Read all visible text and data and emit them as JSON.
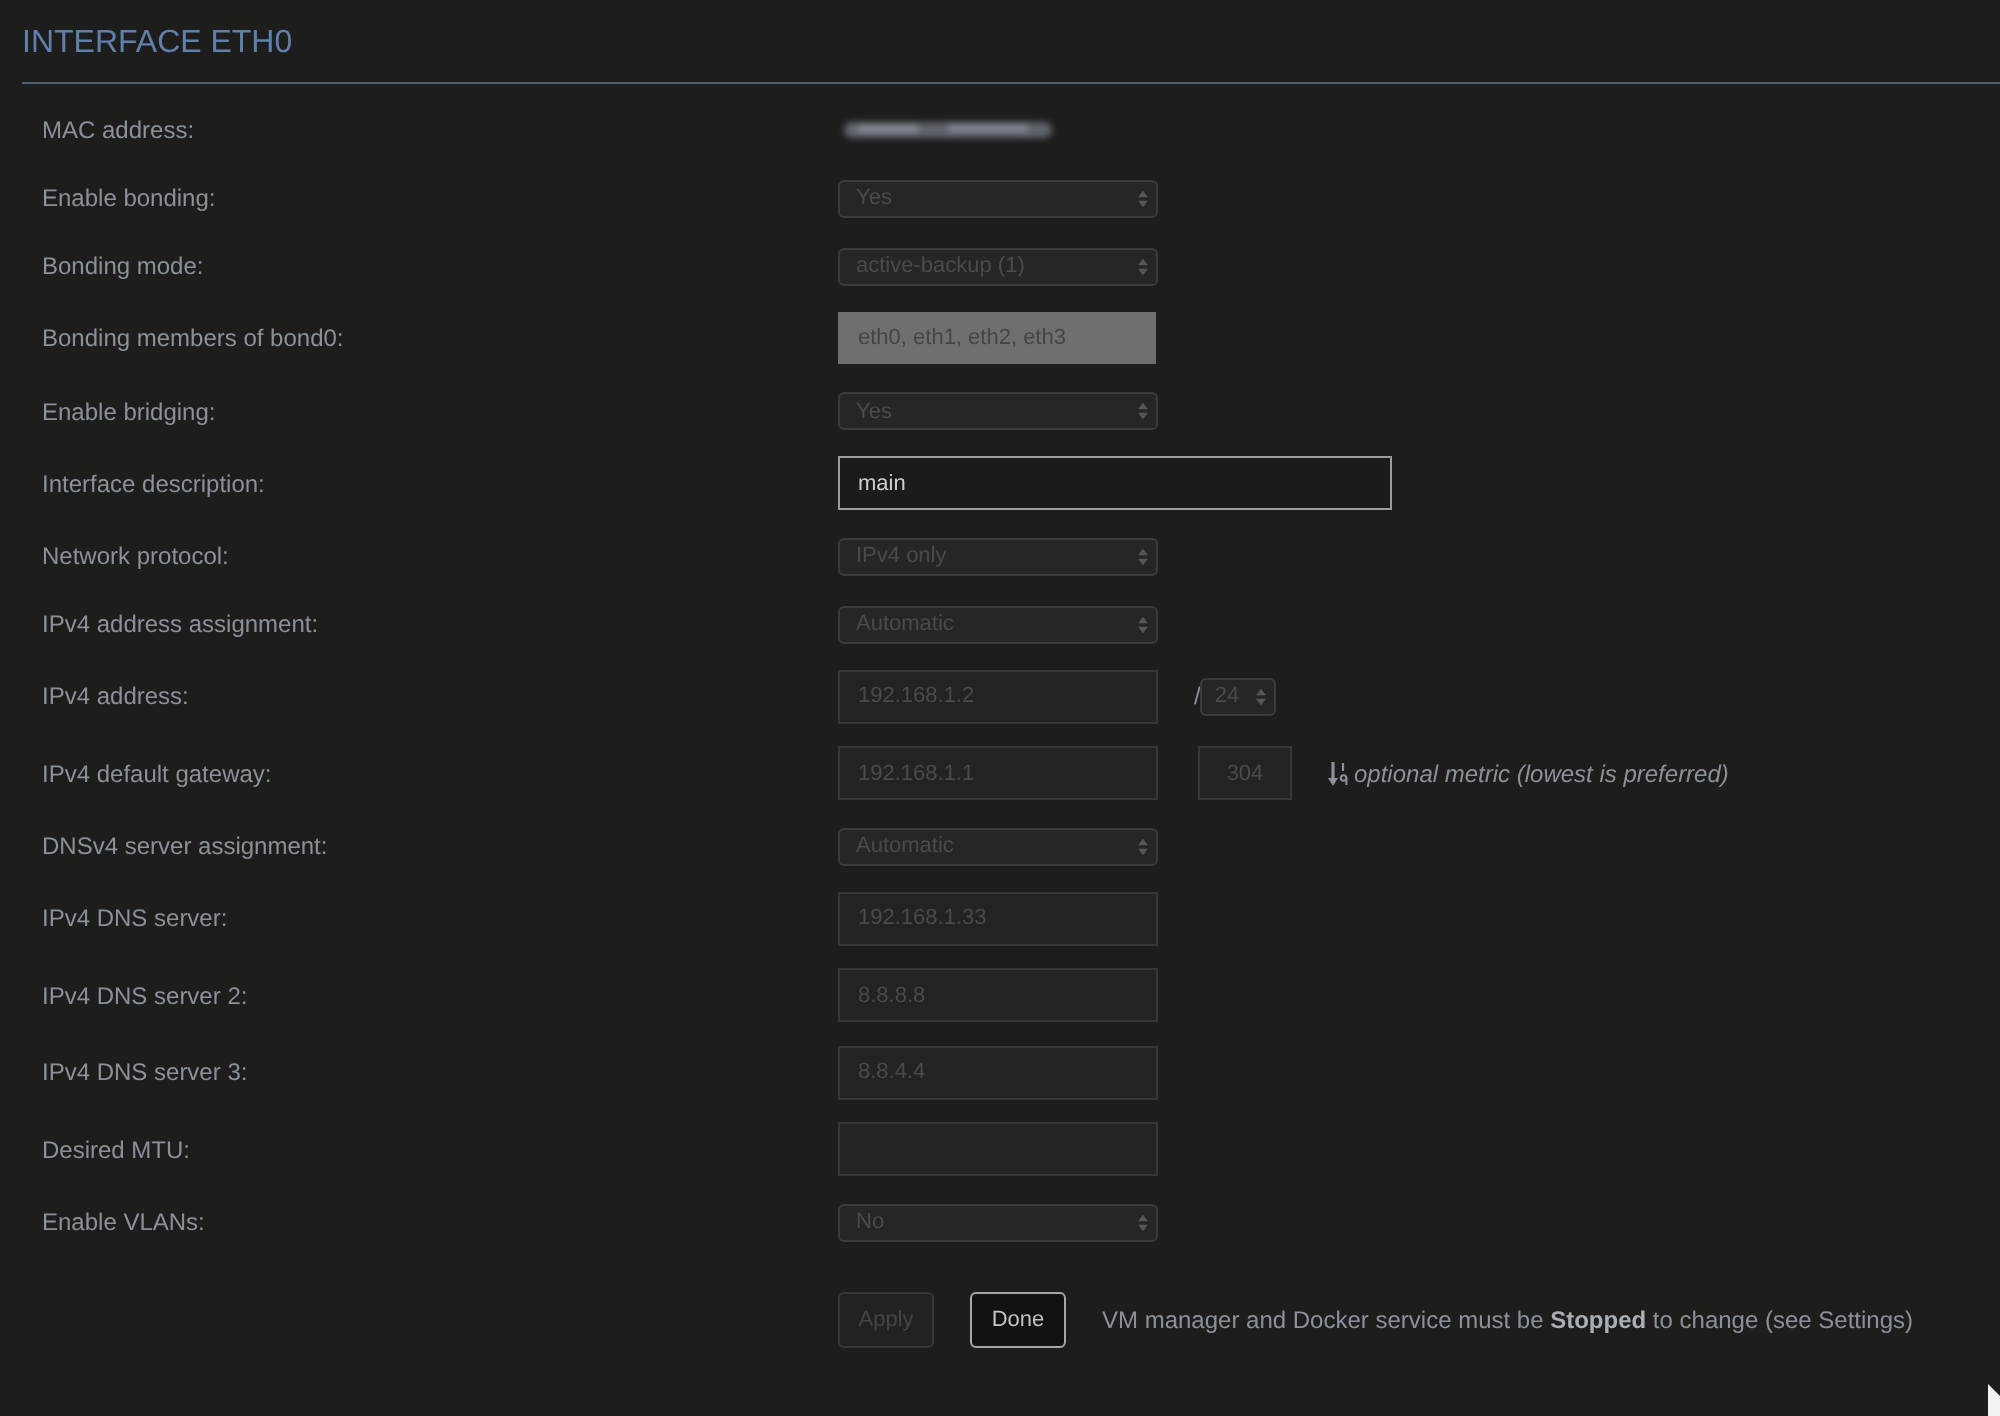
{
  "title": "INTERFACE ETH0",
  "fields": [
    {
      "label": "MAC address:",
      "kind": "redacted"
    },
    {
      "label": "Enable bonding:",
      "kind": "select",
      "value": "Yes",
      "disabled": true
    },
    {
      "label": "Bonding mode:",
      "kind": "select",
      "value": "active-backup (1)",
      "disabled": true
    },
    {
      "label": "Bonding members of bond0:",
      "kind": "readonly",
      "value": "eth0, eth1, eth2, eth3"
    },
    {
      "label": "Enable bridging:",
      "kind": "select",
      "value": "Yes",
      "disabled": true
    },
    {
      "label": "Interface description:",
      "kind": "input",
      "value": "main",
      "disabled": false
    },
    {
      "label": "Network protocol:",
      "kind": "select",
      "value": "IPv4 only",
      "disabled": true
    },
    {
      "label": "IPv4 address assignment:",
      "kind": "select",
      "value": "Automatic",
      "disabled": true
    },
    {
      "label": "IPv4 address:",
      "kind": "input",
      "value": "192.168.1.2",
      "disabled": true,
      "prefix": {
        "separator": "/",
        "value": "24",
        "disabled": true
      }
    },
    {
      "label": "IPv4 default gateway:",
      "kind": "input",
      "value": "192.168.1.1",
      "disabled": true,
      "metric": {
        "value": "304",
        "disabled": true
      },
      "hint": "optional metric (lowest is preferred)"
    },
    {
      "label": "DNSv4 server assignment:",
      "kind": "select",
      "value": "Automatic",
      "disabled": true
    },
    {
      "label": "IPv4 DNS server:",
      "kind": "input",
      "value": "192.168.1.33",
      "disabled": true
    },
    {
      "label": "IPv4 DNS server 2:",
      "kind": "input",
      "value": "8.8.8.8",
      "disabled": true
    },
    {
      "label": "IPv4 DNS server 3:",
      "kind": "input",
      "value": "8.8.4.4",
      "disabled": true
    },
    {
      "label": "Desired MTU:",
      "kind": "input",
      "disabled": true
    },
    {
      "label": "Enable VLANs:",
      "kind": "select",
      "value": "No",
      "disabled": true
    }
  ],
  "buttons": [
    {
      "label": "Apply",
      "disabled": true
    },
    {
      "label": "Done",
      "disabled": false
    }
  ],
  "note": "VM manager and Docker service must be **Stopped** to change (see Settings)"
}
